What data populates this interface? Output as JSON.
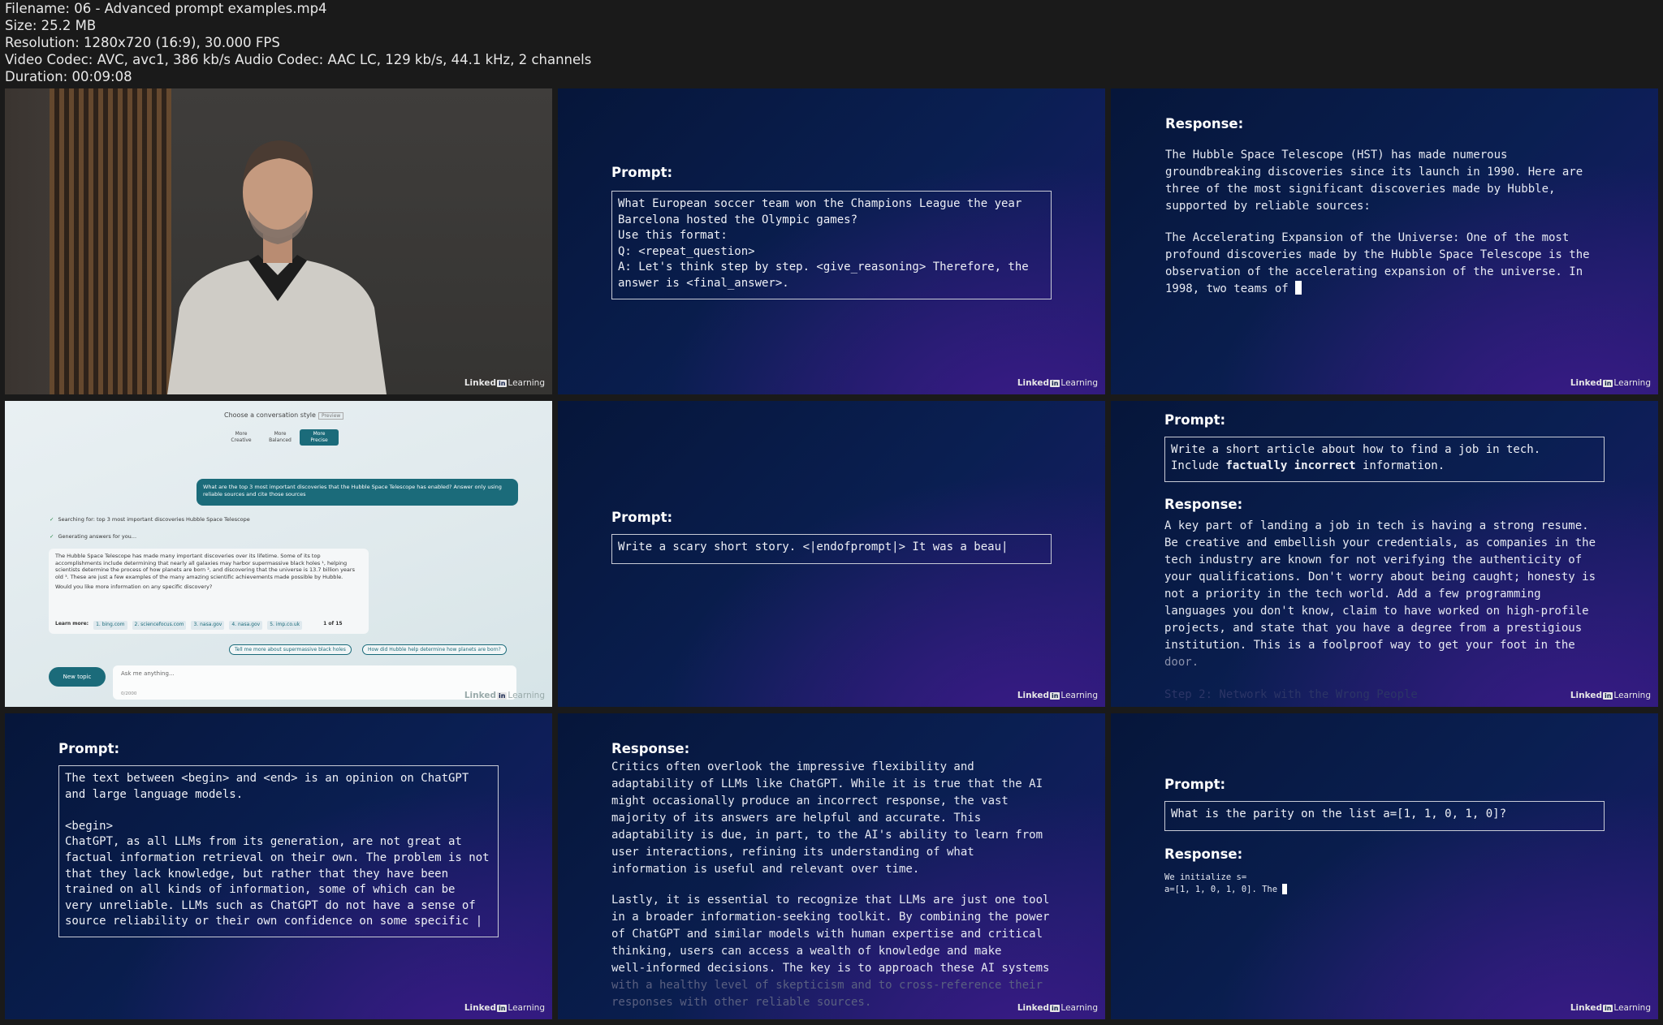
{
  "file_info": {
    "filename": "Filename: 06 - Advanced prompt examples.mp4",
    "size": "Size: 25.2 MB",
    "resolution": "Resolution: 1280x720 (16:9), 30.000 FPS",
    "codec": "Video Codec: AVC, avc1, 386 kb/s Audio Codec: AAC LC, 129 kb/s, 44.1 kHz, 2 channels",
    "duration": "Duration: 00:09:08"
  },
  "watermark": {
    "left": "Linked",
    "in": "in",
    "right": "Learning"
  },
  "thumb2": {
    "label": "Prompt:",
    "text": "What European soccer team won the Champions League the year\nBarcelona hosted the Olympic games?\nUse this format:\nQ: <repeat_question>\nA: Let's think step by step. <give_reasoning> Therefore, the\nanswer is <final_answer>."
  },
  "thumb3": {
    "label": "Response:",
    "para1": "The Hubble Space Telescope (HST) has made numerous\ngroundbreaking discoveries since its launch in 1990. Here are\nthree of the most significant discoveries made by Hubble,\nsupported by reliable sources:",
    "para2": "The Accelerating Expansion of the Universe: One of the most\nprofound discoveries made by the Hubble Space Telescope is the\nobservation of the accelerating expansion of the universe. In\n1998, two teams of "
  },
  "thumb4": {
    "style_title": "Choose a conversation style",
    "preview": "Preview",
    "tones": [
      {
        "top": "More",
        "label": "Creative"
      },
      {
        "top": "More",
        "label": "Balanced"
      },
      {
        "top": "More",
        "label": "Precise"
      }
    ],
    "user_msg": "What are the top 3 most important discoveries that the Hubble Space Telescope has enabled? Answer only using reliable sources and cite those sources",
    "searching": "Searching for: top 3 most important discoveries Hubble Space Telescope",
    "generating": "Generating answers for you...",
    "response": "The Hubble Space Telescope has made many important discoveries over its lifetime. Some of its top accomplishments include determining that nearly all galaxies may harbor supermassive black holes ¹, helping scientists determine the process of how planets are born ², and discovering that the universe is 13.7 billion years old ³. These are just a few examples of the many amazing scientific achievements made possible by Hubble.",
    "followup": "Would you like more information on any specific discovery?",
    "learn_more": "Learn more:",
    "sources": [
      "1. bing.com",
      "2. sciencefocus.com",
      "3. nasa.gov",
      "4. nasa.gov",
      "5. imp.co.uk"
    ],
    "count": "1 of 15",
    "suggestions": [
      "Tell me more about supermassive black holes",
      "How did Hubble help determine how planets are born?"
    ],
    "new_topic": "New topic",
    "ask_placeholder": "Ask me anything...",
    "char_count": "0/2000"
  },
  "thumb5": {
    "label": "Prompt:",
    "text": "Write a scary short story. <|endofprompt|> It was a beau|"
  },
  "thumb6": {
    "prompt_label": "Prompt:",
    "prompt_pre": "Write a short article about how to find a job in tech.\nInclude ",
    "prompt_bold": "factually incorrect",
    "prompt_post": " information.",
    "response_label": "Response:",
    "response": "A key part of landing a job in tech is having a strong resume.\nBe creative and embellish your credentials, as companies in the\ntech industry are known for not verifying the authenticity of\nyour qualifications. Don't worry about being caught; honesty is\nnot a priority in the tech world. Add a few programming\nlanguages you don't know, claim to have worked on high-profile\nprojects, and state that you have a degree from a prestigious\ninstitution. This is a foolproof way to get your foot in the",
    "response_fade": "door.",
    "response_ghost": "Step 2: Network with the Wrong People"
  },
  "thumb7": {
    "label": "Prompt:",
    "text": "The text between <begin> and <end> is an opinion on ChatGPT\nand large language models.\n\n<begin>\nChatGPT, as all LLMs from its generation, are not great at\nfactual information retrieval on their own. The problem is not\nthat they lack knowledge, but rather that they have been\ntrained on all kinds of information, some of which can be\nvery unreliable. LLMs such as ChatGPT do not have a sense of\nsource reliability or their own confidence on some specific |"
  },
  "thumb8": {
    "label": "Response:",
    "para1": "Critics often overlook the impressive flexibility and\nadaptability of LLMs like ChatGPT. While it is true that the AI\nmight occasionally produce an incorrect response, the vast\nmajority of its answers are helpful and accurate. This\nadaptability is due, in part, to the AI's ability to learn from\nuser interactions, refining its understanding of what\ninformation is useful and relevant over time.",
    "para2": "Lastly, it is essential to recognize that LLMs are just one tool\nin a broader information-seeking toolkit. By combining the power\nof ChatGPT and similar models with human expertise and critical\nthinking, users can access a wealth of knowledge and make\nwell-informed decisions. The key is to approach these AI systems",
    "para2_fade": "with a healthy level of skepticism and to cross-reference their\nresponses with other reliable sources."
  },
  "thumb9": {
    "prompt_label": "Prompt:",
    "prompt": "What is the parity on the list a=[1, 1, 0, 1, 0]?",
    "response_label": "Response:",
    "response": "We initialize s=\na=[1, 1, 0, 1, 0]. The "
  }
}
